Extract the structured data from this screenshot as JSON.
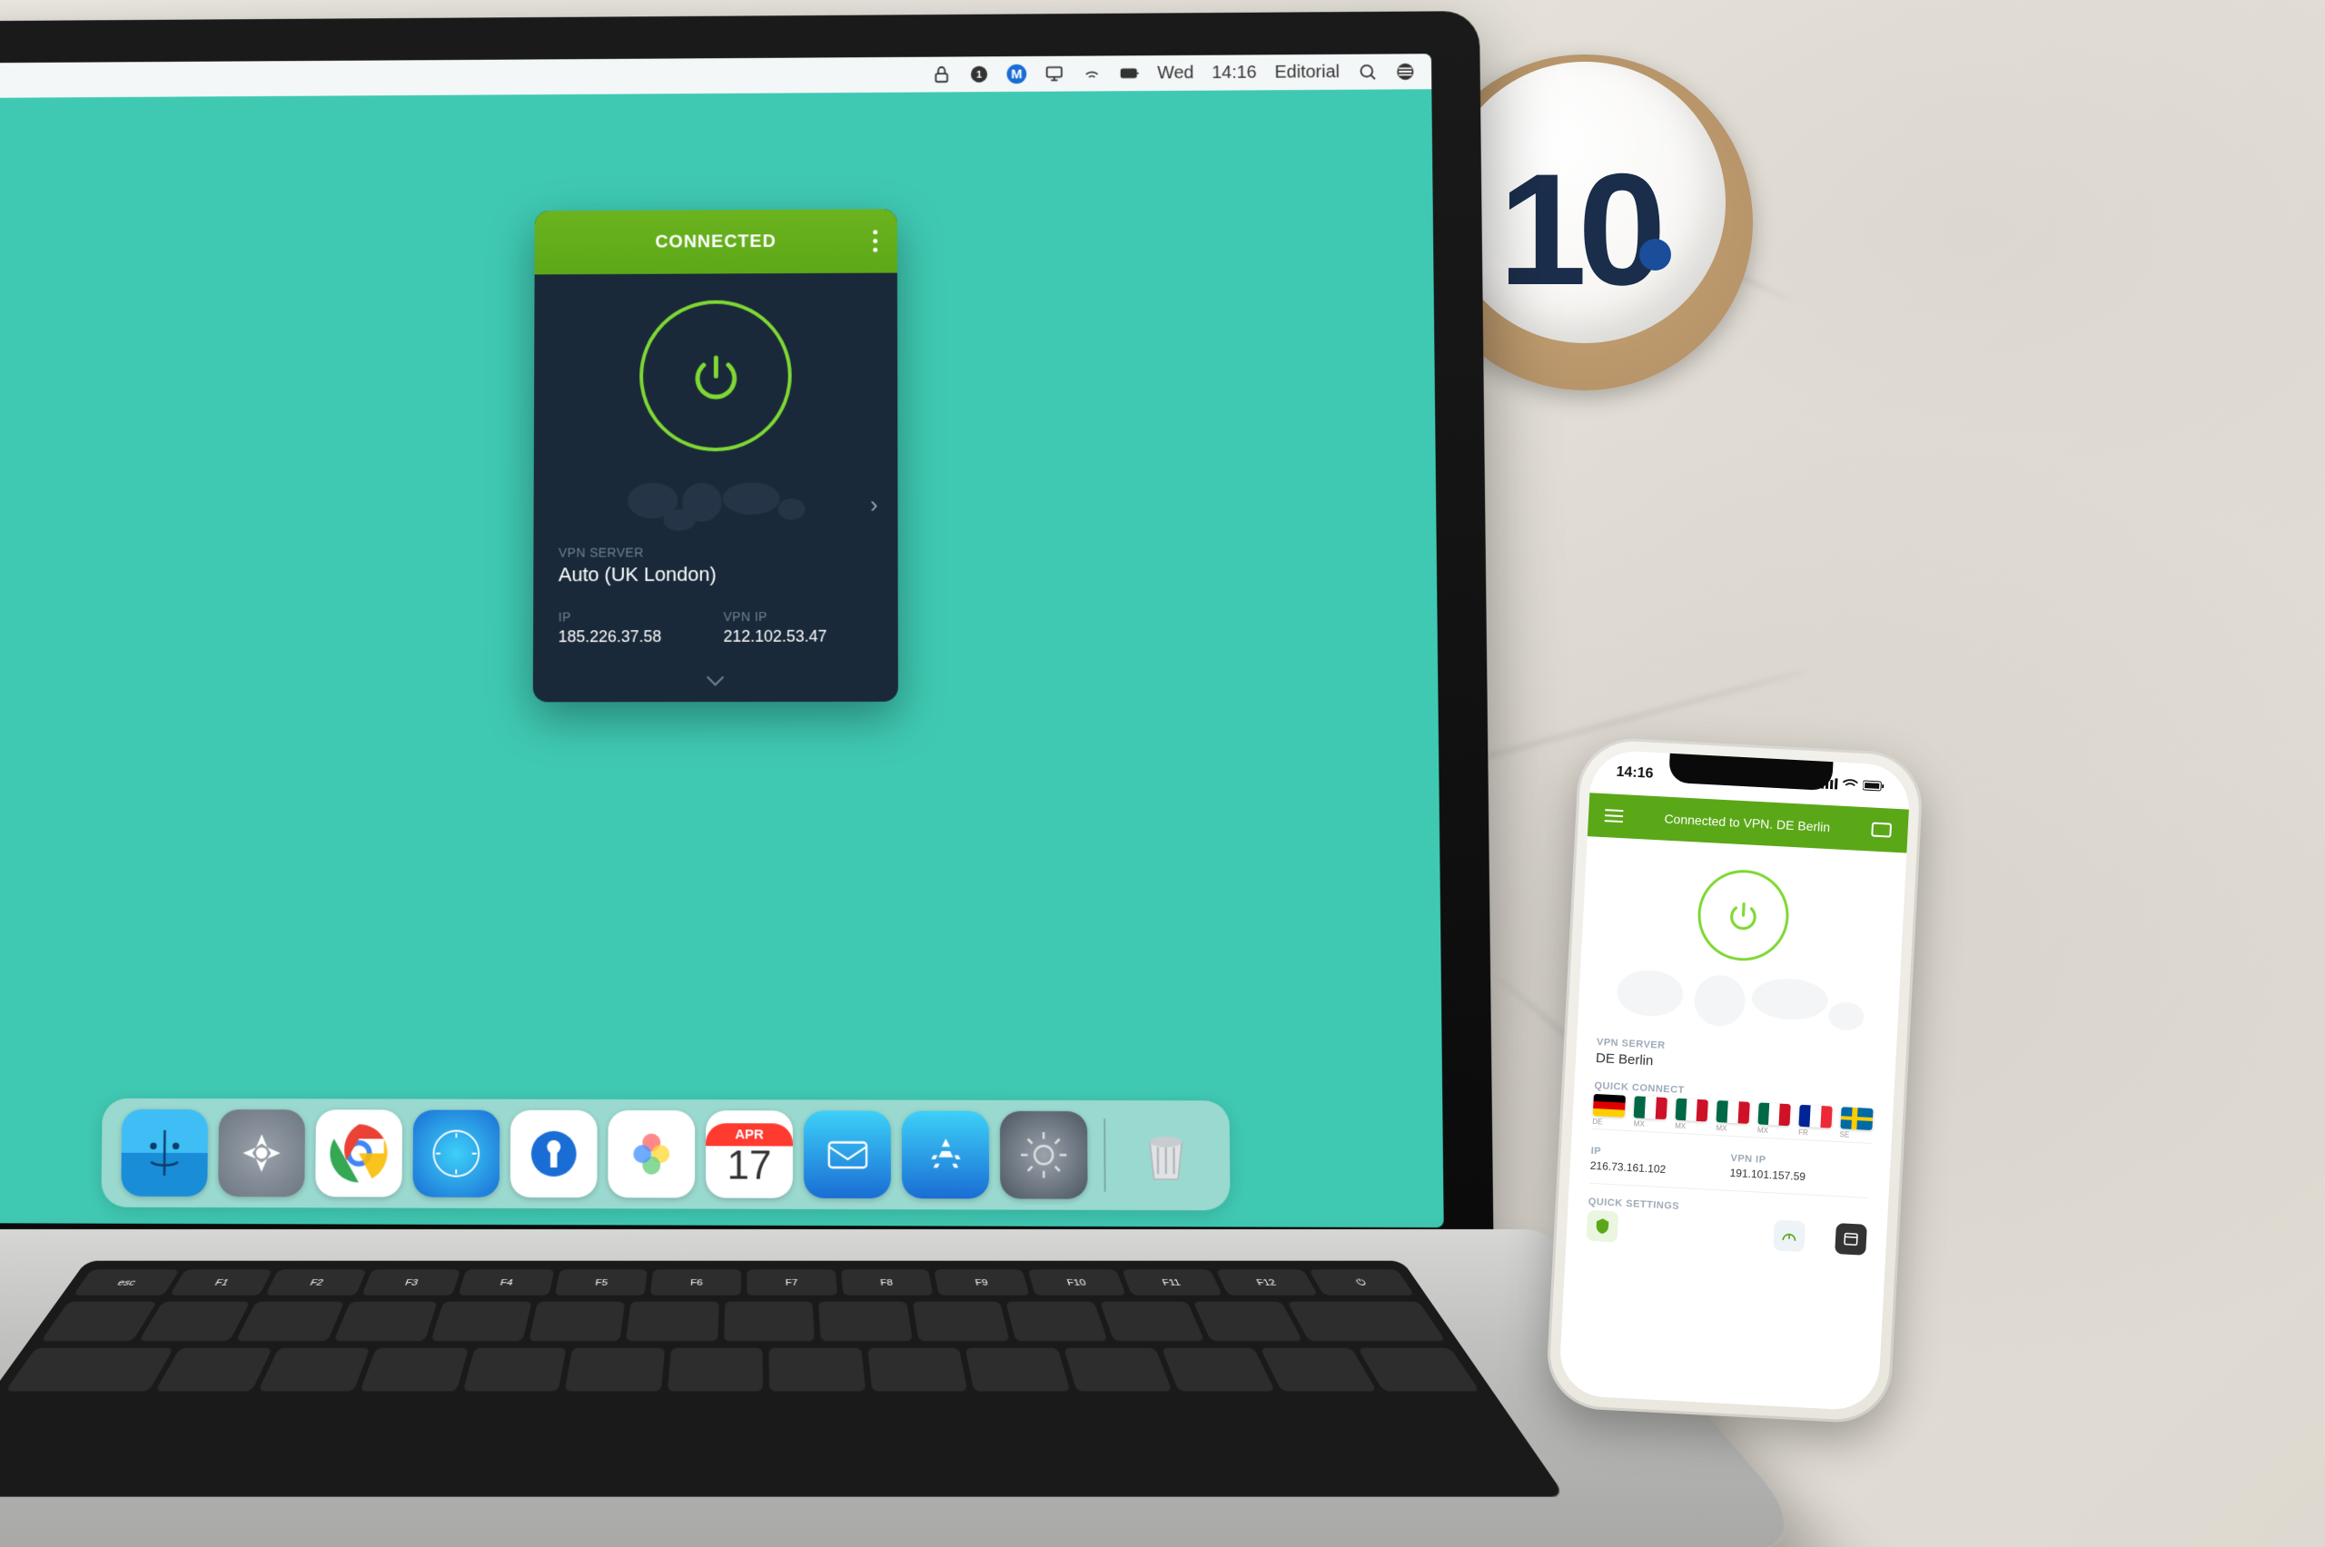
{
  "menubar": {
    "day": "Wed",
    "time": "14:16",
    "user": "Editorial"
  },
  "laptop": {
    "vpn": {
      "status": "CONNECTED",
      "server_label": "VPN SERVER",
      "server_name": "Auto (UK London)",
      "ip_label": "IP",
      "ip_value": "185.226.37.58",
      "vpn_ip_label": "VPN IP",
      "vpn_ip_value": "212.102.53.47"
    },
    "calendar": {
      "month": "APR",
      "day": "17"
    }
  },
  "phone": {
    "statusbar_time": "14:16",
    "header_status": "Connected to VPN. DE Berlin",
    "server_label": "VPN SERVER",
    "server_name": "DE Berlin",
    "quick_connect_label": "QUICK CONNECT",
    "flags": [
      {
        "code": "de",
        "label": "DE"
      },
      {
        "code": "mx",
        "label": "MX"
      },
      {
        "code": "mx",
        "label": "MX"
      },
      {
        "code": "mx",
        "label": "MX"
      },
      {
        "code": "mx",
        "label": "MX"
      },
      {
        "code": "fr",
        "label": "FR"
      },
      {
        "code": "se",
        "label": "SE"
      }
    ],
    "ip_label": "IP",
    "ip_value": "216.73.161.102",
    "vpn_ip_label": "VPN IP",
    "vpn_ip_value": "191.101.157.59",
    "quick_settings_label": "QUICK SETTINGS"
  },
  "mug": {
    "logo_text": "10"
  },
  "colors": {
    "accent_green": "#6bb31e",
    "vpn_dark": "#1a2939",
    "desktop_teal": "#3fc9b3"
  }
}
